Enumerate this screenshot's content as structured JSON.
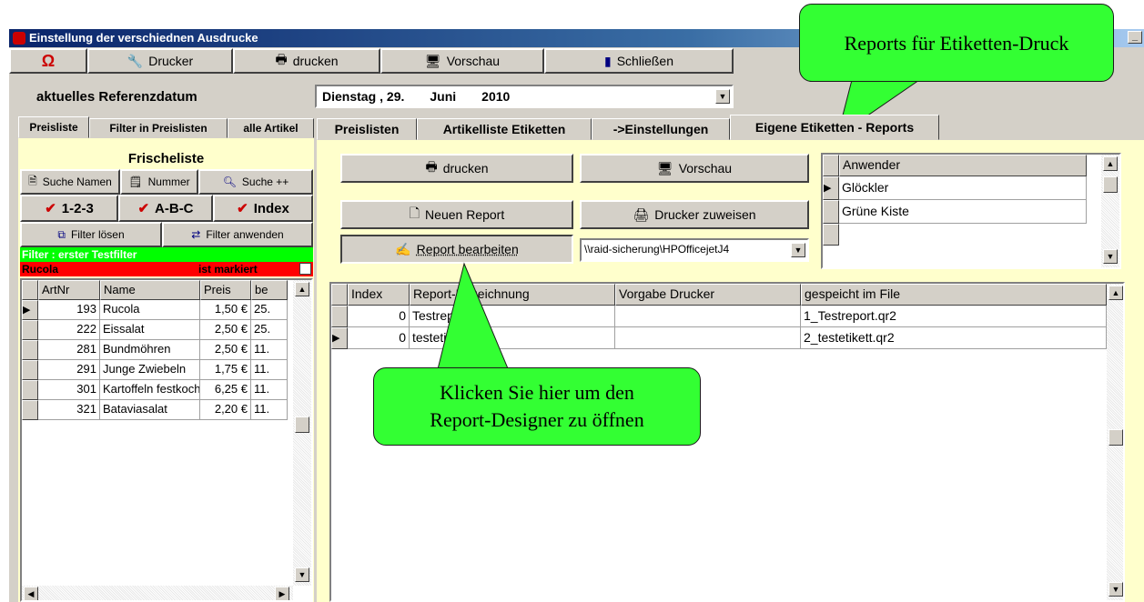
{
  "window": {
    "title": "Einstellung der verschiednen Ausdrucke"
  },
  "toolbar": {
    "drucker": "Drucker",
    "drucken": "drucken",
    "vorschau": "Vorschau",
    "schliessen": "Schließen"
  },
  "refdate": {
    "label": "aktuelles Referenzdatum",
    "weekday": "Dienstag",
    "day": ", 29.",
    "month": "Juni",
    "year": "2010"
  },
  "left_tabs": [
    "Preisliste",
    "Filter in Preislisten",
    "alle Artikel"
  ],
  "left": {
    "title": "Frischeliste",
    "search_name": "Suche Namen",
    "search_number": "Nummer",
    "search_plus": "Suche ++",
    "sort_123": "1-2-3",
    "sort_abc": "A-B-C",
    "sort_index": "Index",
    "filter_clear": "Filter lösen",
    "filter_apply": "Filter anwenden",
    "filter_status": "Filter : erster Testfilter",
    "marked_item": "Rucola",
    "marked_text": "ist markiert",
    "columns": [
      "ArtNr",
      "Name",
      "Preis",
      "be"
    ],
    "rows": [
      {
        "nr": "193",
        "name": "Rucola",
        "price": "1,50 €",
        "be": "25."
      },
      {
        "nr": "222",
        "name": "Eissalat",
        "price": "2,50 €",
        "be": "25."
      },
      {
        "nr": "281",
        "name": "Bundmöhren",
        "price": "2,50 €",
        "be": "11."
      },
      {
        "nr": "291",
        "name": "Junge Zwiebeln",
        "price": "1,75 €",
        "be": "11."
      },
      {
        "nr": "301",
        "name": "Kartoffeln festkoche",
        "price": "6,25 €",
        "be": "11."
      },
      {
        "nr": "321",
        "name": "Bataviasalat",
        "price": "2,20 €",
        "be": "11."
      }
    ]
  },
  "right_tabs": [
    "Preislisten",
    "Artikelliste Etiketten",
    "->Einstellungen",
    "Eigene Etiketten - Reports"
  ],
  "right": {
    "btn_drucken": "drucken",
    "btn_vorschau": "Vorschau",
    "btn_neu": "Neuen Report",
    "btn_drucker_zuweisen": "Drucker zuweisen",
    "btn_bearbeiten": "Report bearbeiten",
    "printer": "\\\\raid-sicherung\\HPOfficejetJ4",
    "user_header": "Anwender",
    "users": [
      "Glöckler",
      "Grüne Kiste"
    ],
    "report_columns": [
      "Index",
      "Report-Bezeichnung",
      "Vorgabe Drucker",
      "gespeicht im File"
    ],
    "reports": [
      {
        "index": "0",
        "name": "Testreport",
        "printer": "",
        "file": "1_Testreport.qr2"
      },
      {
        "index": "0",
        "name": "testetikett",
        "printer": "",
        "file": "2_testetikett.qr2"
      }
    ]
  },
  "callouts": {
    "top": "Reports für Etiketten-Druck",
    "bottom_line1": "Klicken Sie hier um den",
    "bottom_line2": "Report-Designer zu öffnen"
  },
  "colors": {
    "callout": "#33ff33",
    "filter_bar": "#00ff00",
    "marked_bar": "#ff0000",
    "panel": "#ffffcc"
  }
}
